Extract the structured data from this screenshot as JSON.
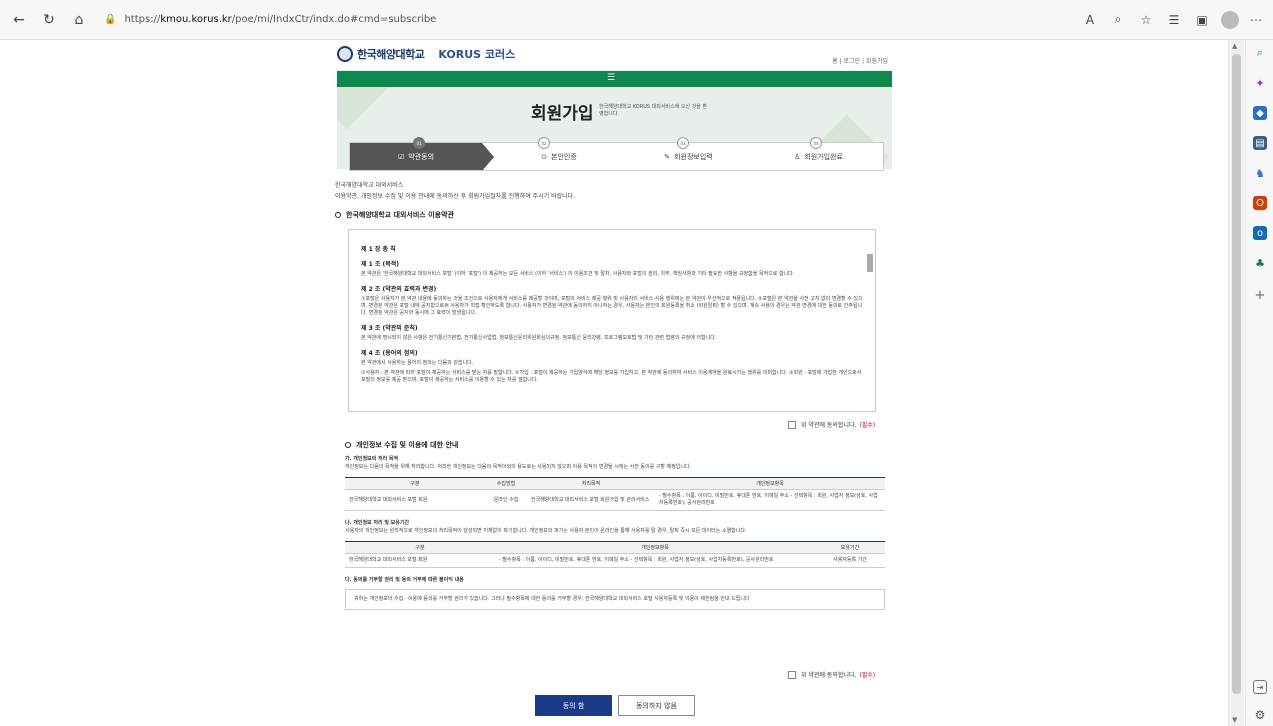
{
  "browser": {
    "url_prefix": "https://",
    "url_host": "kmou.korus.kr",
    "url_path": "/poe/mi/IndxCtr/indx.do#cmd=subscribe",
    "menu_label": "⋯"
  },
  "header": {
    "univ_name": "한국해양대학교",
    "brand": "KORUS 코러스",
    "util_links": "홈  |  로그인  |  회원가입"
  },
  "hero": {
    "title": "회원가입",
    "subtitle": "한국해양대학교 KORUS 대외서비스에 오신 것을 환영합니다."
  },
  "steps": [
    {
      "num": "01",
      "label": "약관동의"
    },
    {
      "num": "02",
      "label": "본인인증"
    },
    {
      "num": "03",
      "label": "회원정보입력"
    },
    {
      "num": "04",
      "label": "회원가입완료"
    }
  ],
  "intro": {
    "line1": "한국해양대학교 대외서비스",
    "line2": "이용약관, 개인정보 수집 및 이용 안내에 동의하신 후 회원가입절차를 진행하여 주시기 바랍니다."
  },
  "terms": {
    "section_title": "한국해양대학교 대외서비스 이용약관",
    "chapter": "제 1 장 총 칙",
    "a1_title": "제 1 조 (목적)",
    "a1_text": "본 약관은 '한국해양대학교 대외서비스 포털' (이하 '포털') 이 제공하는 모든 서비스 (이하 '서비스') 의 이용조건 및 절차, 사용자와 포털의 권리, 의무, 책임사항과 기타 필요한 사항을 규정함을 목적으로 합니다.",
    "a2_title": "제 2 조 (약관의 효력과 변경)",
    "a2_text": "①포털은 사용자가 본 약관 내용에 동의하는 것을 조건으로 사용자에게 서비스를 제공할 것이며, 포털의 서비스 제공 행위 및 사용자의 서비스 사용 행위에는 본 약관이 우선적으로 적용됩니다. ②포털은 본 약관을 사전 고지 없이 변경할 수 있으며, 변경된 약관은 포털 내에 공지함으로써 사용자가 직접 확인하도록 합니다. 사용자가 변경된 약관에 동의하지 아니하는 경우, 사용자는 본인의 회원등록을 취소 (회원탈퇴) 할 수 있으며, 계속 사용의 경우는 약관 변경에 대한 동의로 간주됩니다. 변경된 약관은 공지와 동시에 그 효력이 발생됩니다.",
    "a3_title": "제 3 조 (약관외 준칙)",
    "a3_text": "본 약관에 명시되지 않은 사항은 전기통신기본법, 전기통신사업법, 정보통신윤리위원회심의규정, 정보통신 윤리강령, 프로그램보호법 및 기타 관련 법령의 규정에 의합니다.",
    "a4_title": "제 4 조 (용어의 정의)",
    "a4_text": "본 약관에서 사용하는 용어의 정의는 다음과 같습니다.",
    "a4_items": "①사용자 : 본 약관에 따라 포털이 제공하는 서비스를 받는 자를 말합니다. ②가입 : 포털이 제공하는 가입양식에 해당 정보를 기입하고, 본 약관에 동의하여 서비스 이용계약을 완료시키는 행위를 의미합니다. ③회원 : 포털에 가입한 개인으로서 포털의 정보를 제공 받으며, 포털이 제공하는 서비스를 이용할 수 있는 자를 말합니다.",
    "agree_label": "위 약관에 동의합니다.",
    "required": "(필수)"
  },
  "privacy": {
    "section_title": "개인정보 수집 및 이용에 대한 안내",
    "ga_title": "가. 개인정보의 처리 목적",
    "ga_text": "개인정보는 다음의 목적을 위해 처리합니다. 처리한 개인정보는 다음의 목적이외의 용도로는 사용되지 않으며 이용 목적이 변경될 시에는 사전 동의를 구할 예정입니다.",
    "t1_headers": [
      "구분",
      "수집방법",
      "처리목적",
      "개인정보항목"
    ],
    "t1_row": [
      "한국해양대학교 대외서비스 포털 회원",
      "온라인 수집",
      "한국해양대학교 대외서비스 포털 회원가입 및 관리서비스",
      "- 필수항목 : 이름, 아이디, 비밀번호, 휴대폰 번호, 이메일 주소 - 선택항목 : 회원, 사업자 정보(상호, 사업자등록번호), 공사관리번호"
    ],
    "na_title": "나. 개인정보 처리 및 보유기간",
    "na_text": "사용자의 개인정보는 원칙적으로 개인정보의 처리목적이 달성되면 지체없이 파기합니다. 개인정보의 파기는 사용자 본인이 온라인을 통해 사용자를 탈 경우, 탈퇴 즉시 모든 데이터는 소멸합니다.",
    "t2_headers": [
      "구분",
      "개인정보항목",
      "보유기간"
    ],
    "t2_row": [
      "한국해양대학교 대외서비스 포털 회원",
      "- 필수항목 : 이름, 아이디, 비밀번호, 휴대폰 번호, 이메일 주소 - 선택항목 : 회원, 사업자 정보(상호, 사업자등록번호), 공사관리번호",
      "사용자등록 기간"
    ],
    "da_title": "다. 동의를 거부할 권리 및 동의 거부에 따른 불이익 내용",
    "da_text": "귀하는 개인정보의 수집 · 이용에 동의를 거부할 권리가 있습니다. 그러나 필수항목에 대한 동의를 거부할 경우, 한국해양대학교 대외서비스 포털 사용자등록 및 이용이 제한됨을 안내 드립니다",
    "agree_label": "위 약관에 동의합니다.",
    "required": "(필수)"
  },
  "buttons": {
    "agree": "동의 함",
    "disagree": "동의하지 않음"
  },
  "colors": {
    "green": "#0b8a4d",
    "navy": "#1a3a8a",
    "active_step": "#555555"
  }
}
